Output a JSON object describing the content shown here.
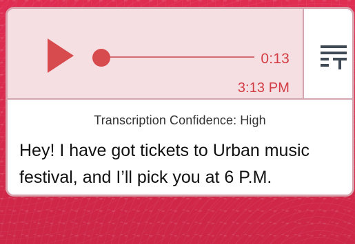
{
  "player": {
    "current_time": "0:13",
    "timestamp": "3:13 PM"
  },
  "transcription": {
    "confidence_label": "Transcription Confidence: High",
    "text": "Hey! I have got tickets to Urban music festival, and I’ll pick you at 6 P.M."
  },
  "icons": {
    "play": "play-icon",
    "transcript": "transcript-icon"
  },
  "colors": {
    "background": "#d72a4c",
    "player_background": "#f6dfe2",
    "accent": "#d23d45",
    "border": "#d2a6ae"
  }
}
